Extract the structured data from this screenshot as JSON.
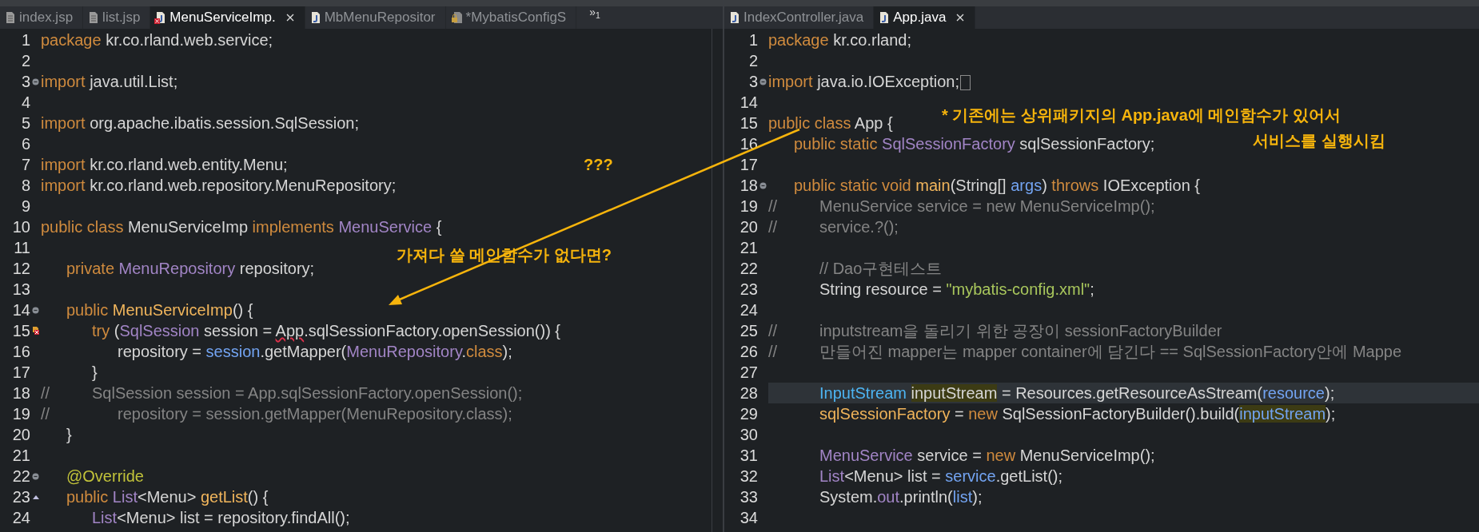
{
  "panes": [
    {
      "tabs": [
        {
          "label": "index.jsp",
          "kind": "page",
          "selected": false,
          "error": false
        },
        {
          "label": "list.jsp",
          "kind": "page",
          "selected": false,
          "error": false
        },
        {
          "label": "MenuServiceImp.",
          "kind": "java",
          "selected": true,
          "error": true
        },
        {
          "label": "MbMenuRepositor",
          "kind": "java",
          "selected": false,
          "error": false
        },
        {
          "label": "*MybatisConfigS",
          "kind": "locked",
          "selected": false,
          "error": false
        }
      ],
      "overflow": "»$_{1}$",
      "lines": [
        {
          "num": "1",
          "tokens": [
            {
              "t": "package",
              "kind": "keyword"
            },
            {
              "t": " kr.co.rland.web.service;",
              "kind": "plain"
            }
          ]
        },
        {
          "num": "2"
        },
        {
          "num": "3",
          "kind": "fold",
          "tokens": [
            {
              "t": "import",
              "kind": "keyword"
            },
            {
              "t": " java.util.List;",
              "kind": "plain"
            }
          ]
        },
        {
          "num": "4"
        },
        {
          "num": "5",
          "tokens": [
            {
              "t": "import",
              "kind": "keyword"
            },
            {
              "t": " org.apache.ibatis.session.SqlSession;",
              "kind": "plain"
            }
          ]
        },
        {
          "num": "6"
        },
        {
          "num": "7",
          "tokens": [
            {
              "t": "import",
              "kind": "keyword"
            },
            {
              "t": " kr.co.rland.web.entity.Menu;",
              "kind": "plain"
            }
          ]
        },
        {
          "num": "8",
          "tokens": [
            {
              "t": "import",
              "kind": "keyword"
            },
            {
              "t": " kr.co.rland.web.repository.MenuRepository;",
              "kind": "plain"
            }
          ]
        },
        {
          "num": "9"
        },
        {
          "num": "10",
          "tokens": [
            {
              "t": "public class",
              "kind": "keyword"
            },
            {
              "t": " MenuServiceImp ",
              "kind": "plain"
            },
            {
              "t": "implements",
              "kind": "keyword"
            },
            {
              "t": " MenuService",
              "kind": "type"
            },
            {
              "t": " {",
              "kind": "plain"
            }
          ]
        },
        {
          "num": "11"
        },
        {
          "num": "12",
          "tokens": [
            {
              "t": "\tprivate",
              "kind": "keyword"
            },
            {
              "t": " MenuRepository",
              "kind": "type"
            },
            {
              "t": " repository;",
              "kind": "plain"
            }
          ]
        },
        {
          "num": "13"
        },
        {
          "num": "14",
          "kind": "fold",
          "tokens": [
            {
              "t": "\tpublic",
              "kind": "keyword"
            },
            {
              "t": " MenuServiceImp",
              "kind": "method"
            },
            {
              "t": "() {",
              "kind": "plain"
            }
          ]
        },
        {
          "num": "15",
          "kind": "error",
          "tokens": [
            {
              "t": "\t\ttry",
              "kind": "keyword"
            },
            {
              "t": " (",
              "kind": "plain"
            },
            {
              "t": "SqlSession",
              "kind": "type"
            },
            {
              "t": " session = ",
              "kind": "plain"
            },
            {
              "t": "App",
              "kind": "error"
            },
            {
              "t": ".sqlSessionFactory.openSession()) {",
              "kind": "plain"
            }
          ]
        },
        {
          "num": "16",
          "tokens": [
            {
              "t": "\t\t\trepository = ",
              "kind": "plain"
            },
            {
              "t": "session",
              "kind": "field"
            },
            {
              "t": ".getMapper(",
              "kind": "plain"
            },
            {
              "t": "MenuRepository",
              "kind": "type"
            },
            {
              "t": ".",
              "kind": "plain"
            },
            {
              "t": "class",
              "kind": "keyword"
            },
            {
              "t": ");",
              "kind": "plain"
            }
          ]
        },
        {
          "num": "17",
          "tokens": [
            {
              "t": "\t\t}",
              "kind": "plain"
            }
          ]
        },
        {
          "num": "18",
          "tokens": [
            {
              "t": "//\t\tSqlSession session = App.sqlSessionFactory.openSession();",
              "kind": "comment"
            }
          ]
        },
        {
          "num": "19",
          "tokens": [
            {
              "t": "//\t\t\trepository = session.getMapper(MenuRepository.class);",
              "kind": "comment"
            }
          ]
        },
        {
          "num": "20",
          "tokens": [
            {
              "t": "\t}",
              "kind": "plain"
            }
          ]
        },
        {
          "num": "21"
        },
        {
          "num": "22",
          "kind": "fold",
          "tokens": [
            {
              "t": "\t@Override",
              "kind": "annotation"
            }
          ]
        },
        {
          "num": "23",
          "kind": "override",
          "tokens": [
            {
              "t": "\tpublic",
              "kind": "keyword"
            },
            {
              "t": " List",
              "kind": "type"
            },
            {
              "t": "<Menu> ",
              "kind": "plain"
            },
            {
              "t": "getList",
              "kind": "method"
            },
            {
              "t": "() {",
              "kind": "plain"
            }
          ]
        },
        {
          "num": "24",
          "tokens": [
            {
              "t": "\t\tList",
              "kind": "type"
            },
            {
              "t": "<Menu> list = repository.findAll();",
              "kind": "plain"
            }
          ]
        }
      ]
    },
    {
      "tabs": [
        {
          "label": "IndexController.java",
          "kind": "java",
          "selected": false,
          "error": false
        },
        {
          "label": "App.java",
          "kind": "java",
          "selected": true,
          "error": false
        }
      ],
      "lines": [
        {
          "num": "1",
          "tokens": [
            {
              "t": "package",
              "kind": "keyword"
            },
            {
              "t": " kr.co.rland;",
              "kind": "plain"
            }
          ]
        },
        {
          "num": "2"
        },
        {
          "num": "3",
          "kind": "fold",
          "folded": true,
          "tokens": [
            {
              "t": "import",
              "kind": "keyword"
            },
            {
              "t": " java.io.IOException;",
              "kind": "plain"
            }
          ]
        },
        {
          "num": "14"
        },
        {
          "num": "15",
          "tokens": [
            {
              "t": "public class",
              "kind": "keyword"
            },
            {
              "t": " App {",
              "kind": "plain"
            }
          ]
        },
        {
          "num": "16",
          "tokens": [
            {
              "t": "\tpublic static",
              "kind": "keyword"
            },
            {
              "t": " SqlSessionFactory",
              "kind": "type"
            },
            {
              "t": " sqlSessionFactory;",
              "kind": "plain"
            }
          ]
        },
        {
          "num": "17"
        },
        {
          "num": "18",
          "kind": "fold",
          "tokens": [
            {
              "t": "\tpublic static void",
              "kind": "keyword"
            },
            {
              "t": " main",
              "kind": "method"
            },
            {
              "t": "(String[] ",
              "kind": "plain"
            },
            {
              "t": "args",
              "kind": "field"
            },
            {
              "t": ") ",
              "kind": "plain"
            },
            {
              "t": "throws",
              "kind": "keyword"
            },
            {
              "t": " IOException {",
              "kind": "plain"
            }
          ]
        },
        {
          "num": "19",
          "tokens": [
            {
              "t": "//\t\tMenuService service = new MenuServiceImp();",
              "kind": "comment"
            }
          ]
        },
        {
          "num": "20",
          "tokens": [
            {
              "t": "//\t\tservice.?();",
              "kind": "comment"
            }
          ]
        },
        {
          "num": "21"
        },
        {
          "num": "22",
          "tokens": [
            {
              "t": "\t\t// Dao구현테스트",
              "kind": "comment"
            }
          ]
        },
        {
          "num": "23",
          "tokens": [
            {
              "t": "\t\tString resource = ",
              "kind": "plain"
            },
            {
              "t": "\"mybatis-config.xml\"",
              "kind": "string"
            },
            {
              "t": ";",
              "kind": "plain"
            }
          ]
        },
        {
          "num": "24"
        },
        {
          "num": "25",
          "tokens": [
            {
              "t": "//\t\tinputstream을 돌리기 위한 공장이 sessionFactoryBuilder",
              "kind": "comment"
            }
          ]
        },
        {
          "num": "26",
          "tokens": [
            {
              "t": "//\t\t만들어진 mapper는 mapper container에 담긴다 == SqlSessionFactory안에 Mappe",
              "kind": "comment"
            }
          ]
        },
        {
          "num": "27"
        },
        {
          "num": "28",
          "current": true,
          "tokens": [
            {
              "t": "\t\tInputStream ",
              "kind": "class"
            },
            {
              "t": "inputStream",
              "kind": "plain",
              "highlighted": true
            },
            {
              "t": " = Resources.getResourceAsStream(",
              "kind": "plain"
            },
            {
              "t": "resource",
              "kind": "field"
            },
            {
              "t": ");",
              "kind": "plain"
            }
          ]
        },
        {
          "num": "29",
          "tokens": [
            {
              "t": "\t\tsqlSessionFactory",
              "kind": "static"
            },
            {
              "t": " = ",
              "kind": "plain"
            },
            {
              "t": "new",
              "kind": "keyword"
            },
            {
              "t": " SqlSessionFactoryBuilder().build(",
              "kind": "plain"
            },
            {
              "t": "inputStream",
              "kind": "field",
              "highlighted": true
            },
            {
              "t": ");",
              "kind": "plain"
            }
          ]
        },
        {
          "num": "30"
        },
        {
          "num": "31",
          "tokens": [
            {
              "t": "\t\tMenuService",
              "kind": "type"
            },
            {
              "t": " service = ",
              "kind": "plain"
            },
            {
              "t": "new",
              "kind": "keyword"
            },
            {
              "t": " MenuServiceImp();",
              "kind": "plain"
            }
          ]
        },
        {
          "num": "32",
          "tokens": [
            {
              "t": "\t\tList",
              "kind": "type"
            },
            {
              "t": "<Menu> list = ",
              "kind": "plain"
            },
            {
              "t": "service",
              "kind": "field"
            },
            {
              "t": ".getList();",
              "kind": "plain"
            }
          ]
        },
        {
          "num": "33",
          "tokens": [
            {
              "t": "\t\tSystem.",
              "kind": "plain"
            },
            {
              "t": "out",
              "kind": "type"
            },
            {
              "t": ".println(",
              "kind": "plain"
            },
            {
              "t": "list",
              "kind": "field"
            },
            {
              "t": ");",
              "kind": "plain"
            }
          ]
        },
        {
          "num": "34"
        }
      ]
    }
  ],
  "annotations": [
    {
      "text": "???"
    },
    {
      "text": "가져다 쓸 메인함수가 없다면?"
    },
    {
      "text": "* 기존에는 상위패키지의 App.java에 메인함수가 있어서"
    },
    {
      "text": "서비스를 실행시킴"
    }
  ]
}
